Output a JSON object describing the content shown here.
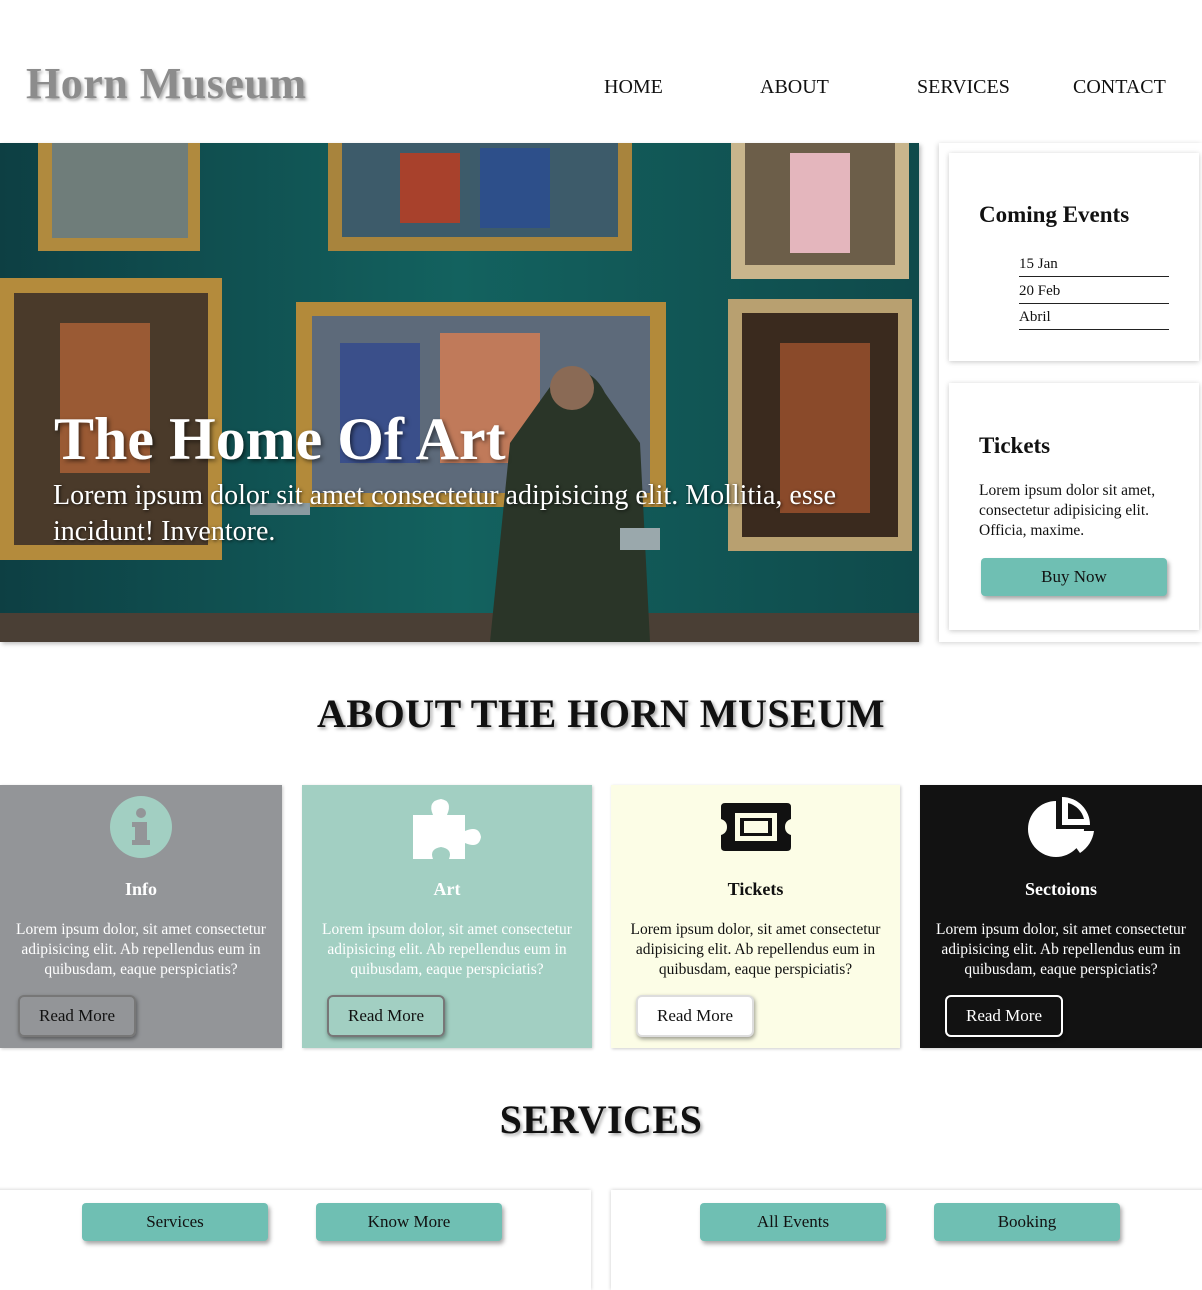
{
  "header": {
    "logo": "Horn Museum",
    "nav": [
      "HOME",
      "ABOUT",
      "SERVICES",
      "CONTACT"
    ]
  },
  "hero": {
    "title": "The Home Of Art",
    "text": "Lorem ipsum dolor sit amet consectetur adipisicing elit. Mollitia, esse incidunt! Inventore."
  },
  "sidebar": {
    "events": {
      "title": "Coming Events",
      "items": [
        "15 Jan",
        "20 Feb",
        "Abril"
      ]
    },
    "tickets": {
      "title": "Tickets",
      "text": "Lorem ipsum dolor sit amet, consectetur adipisicing elit. Officia, maxime.",
      "button": "Buy Now"
    }
  },
  "about": {
    "heading": "ABOUT THE HORN MUSEUM",
    "cards": [
      {
        "title": "Info",
        "icon": "info-icon",
        "text": "Lorem ipsum dolor, sit amet consectetur adipisicing elit. Ab repellendus eum in quibusdam, eaque perspiciatis?",
        "button": "Read More",
        "bg": "#939598"
      },
      {
        "title": "Art",
        "icon": "puzzle-icon",
        "text": "Lorem ipsum dolor, sit amet consectetur adipisicing elit. Ab repellendus eum in quibusdam, eaque perspiciatis?",
        "button": "Read More",
        "bg": "#a2cfc2"
      },
      {
        "title": "Tickets",
        "icon": "ticket-icon",
        "text": "Lorem ipsum dolor, sit amet consectetur adipisicing elit. Ab repellendus eum in quibusdam, eaque perspiciatis?",
        "button": "Read More",
        "bg": "#fcfde6"
      },
      {
        "title": "Sectoions",
        "icon": "pie-chart-icon",
        "text": "Lorem ipsum dolor, sit amet consectetur adipisicing elit. Ab repellendus eum in quibusdam, eaque perspiciatis?",
        "button": "Read More",
        "bg": "#121212"
      }
    ]
  },
  "services": {
    "heading": "SERVICES",
    "buttons": [
      "Services",
      "Know More",
      "All Events",
      "Booking"
    ]
  },
  "colors": {
    "accent": "#6fbfb3",
    "logo": "#8c8c8c"
  }
}
